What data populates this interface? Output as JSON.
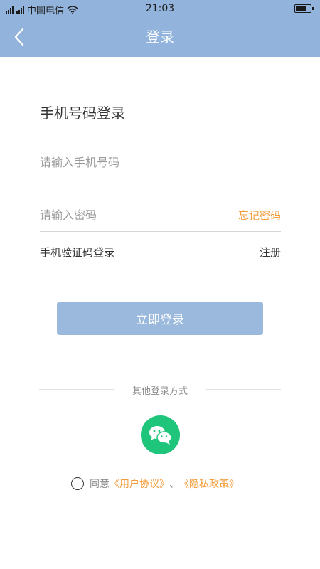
{
  "status_bar": {
    "carrier": "中国电信",
    "time": "21:03",
    "battery_level": 0.75
  },
  "nav": {
    "title": "登录"
  },
  "form": {
    "section_title": "手机号码登录",
    "phone_placeholder": "请输入手机号码",
    "password_placeholder": "请输入密码",
    "forgot_label": "忘记密码",
    "sms_login_label": "手机验证码登录",
    "register_label": "注册",
    "submit_label": "立即登录"
  },
  "other_login": {
    "label": "其他登录方式"
  },
  "agreement": {
    "prefix": "同意",
    "user_agreement": "《用户协议》",
    "separator": "、",
    "privacy_policy": "《隐私政策》"
  },
  "colors": {
    "header": "#92b4dc",
    "button": "#9ab9dd",
    "accent": "#f39c3c",
    "wechat": "#1ec57a"
  }
}
